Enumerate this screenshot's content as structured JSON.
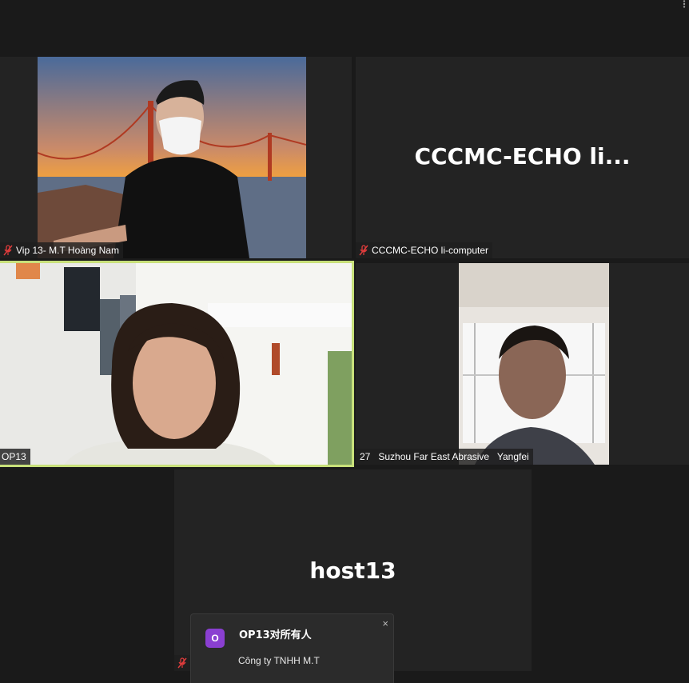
{
  "participants": [
    {
      "display_name": "Vip 13- M.T Hoàng Nam",
      "muted": true,
      "video": "on"
    },
    {
      "display_name": "CCCMC-ECHO li-computer",
      "tile_label": "CCCMC-ECHO  li...",
      "muted": true,
      "video": "off"
    },
    {
      "display_name": "OP13",
      "muted": false,
      "video": "on",
      "active_speaker": true
    },
    {
      "display_name": "27   Suzhou Far East Abrasive   Yangfei",
      "muted": false,
      "video": "on"
    },
    {
      "display_name": "host13",
      "tile_label": "host13",
      "muted": true,
      "video": "off"
    }
  ],
  "chat_notification": {
    "avatar_letter": "O",
    "title": "OP13对所有人",
    "message": "Công ty TNHH M.T",
    "close_symbol": "×"
  },
  "colors": {
    "active_speaker_border": "#c8e07a",
    "mute_icon": "#e03c3c",
    "avatar": "#8a3fd1"
  }
}
